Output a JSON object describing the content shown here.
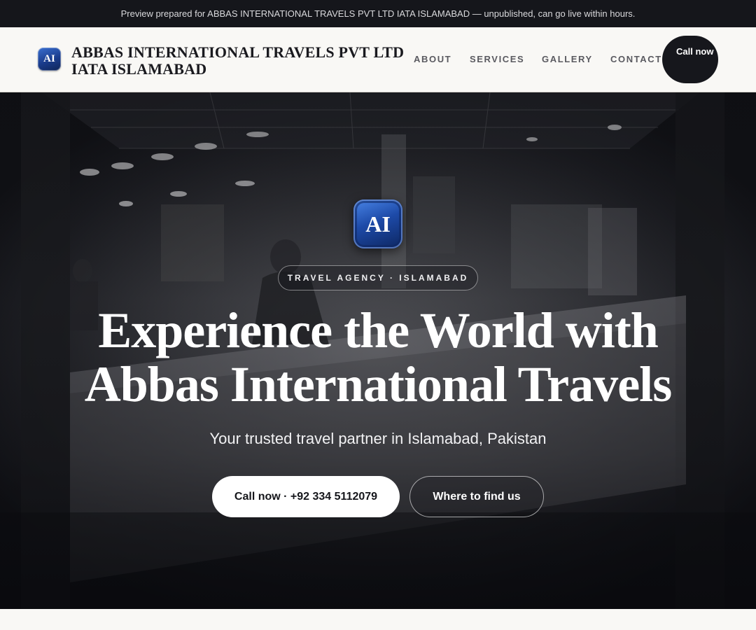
{
  "announcement": "Preview prepared for ABBAS INTERNATIONAL TRAVELS PVT LTD IATA ISLAMABAD — unpublished, can go live within hours.",
  "header": {
    "logo_mark": "AI",
    "brand_name": "ABBAS INTERNATIONAL TRAVELS PVT LTD IATA ISLAMABAD",
    "nav": {
      "about": "ABOUT",
      "services": "SERVICES",
      "gallery": "GALLERY",
      "contact": "CONTACT"
    },
    "call_button": "Call now"
  },
  "hero": {
    "logo_mark": "AI",
    "eyebrow": "TRAVEL AGENCY · ISLAMABAD",
    "title": "Experience the World with Abbas International Travels",
    "subtitle": "Your trusted travel partner in Islamabad, Pakistan",
    "primary_cta": "Call now · +92 334 5112079",
    "secondary_cta": "Where to find us"
  },
  "colors": {
    "announcement_bg": "#15161b",
    "header_bg": "#f9f8f5",
    "logo_blue": "#1d4aa8",
    "call_pill_bg": "#16171c"
  }
}
